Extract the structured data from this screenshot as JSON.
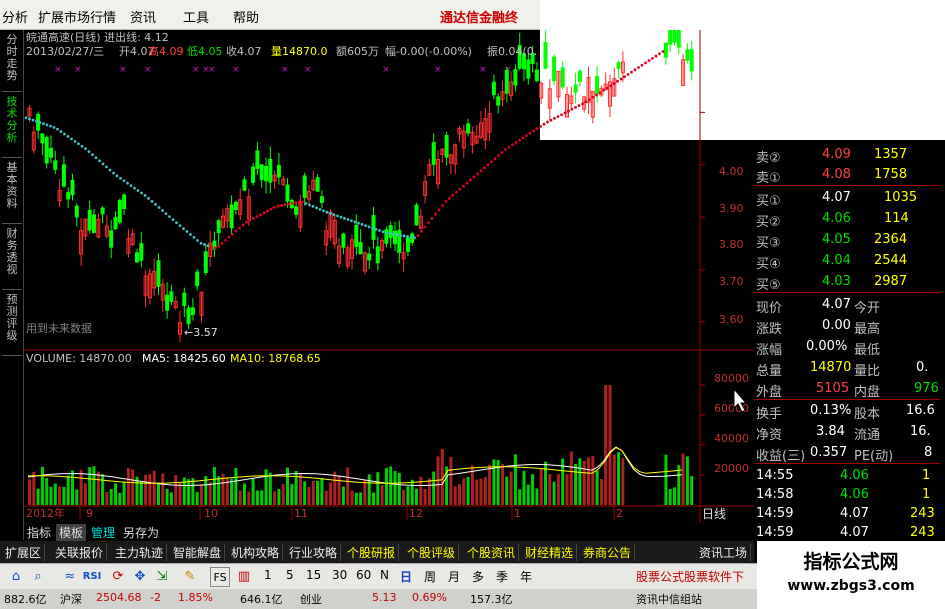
{
  "menu": {
    "item0": "分析",
    "item1": "扩展市场行情",
    "item2": "资讯",
    "item3": "工具",
    "item4": "帮助",
    "brand": "通达信金融终"
  },
  "left_tabs": [
    "分时走势",
    "技术分析",
    "基本资料",
    "财务透视",
    "预测评级"
  ],
  "chart_header": {
    "line1": "皖通高速(日线) 进出线: 4.12",
    "date": "2013/02/27/三",
    "open": "开4.07",
    "high": "高4.09",
    "low": "低4.05",
    "close": "收4.07",
    "vol": "量14870.0",
    "amount": "额605万",
    "range": "幅-0.00(-0.00%)",
    "amp": "振0.04(0.",
    "low_marker": "←3.57",
    "future": "用到未来数据"
  },
  "volume_header": {
    "vol": "VOLUME: 14870.00",
    "ma5": "MA5: 18425.60",
    "ma10": "MA10: 18768.65"
  },
  "price_axis": [
    "4.00",
    "3.90",
    "3.80",
    "3.70",
    "3.60"
  ],
  "vol_axis": [
    "80000",
    "60000",
    "40000",
    "20000"
  ],
  "x_axis": [
    "2012年",
    "9",
    "10",
    "11",
    "12",
    "1",
    "2"
  ],
  "period": "日线",
  "quote": {
    "asks": [
      {
        "label": "卖②",
        "price": "4.09",
        "vol": "1357"
      },
      {
        "label": "卖①",
        "price": "4.08",
        "vol": "1758"
      }
    ],
    "bids": [
      {
        "label": "买①",
        "price": "4.07",
        "vol": "1035"
      },
      {
        "label": "买②",
        "price": "4.06",
        "vol": "114"
      },
      {
        "label": "买③",
        "price": "4.05",
        "vol": "2364"
      },
      {
        "label": "买④",
        "price": "4.04",
        "vol": "2544"
      },
      {
        "label": "买⑤",
        "price": "4.03",
        "vol": "2987"
      }
    ],
    "stats": [
      {
        "k1": "现价",
        "v1": "4.07",
        "k2": "今开",
        "v2": ""
      },
      {
        "k1": "涨跌",
        "v1": "0.00",
        "k2": "最高",
        "v2": ""
      },
      {
        "k1": "涨幅",
        "v1": "0.00%",
        "k2": "最低",
        "v2": ""
      },
      {
        "k1": "总量",
        "v1": "14870",
        "k2": "量比",
        "v2": "0."
      },
      {
        "k1": "外盘",
        "v1": "5105",
        "k2": "内盘",
        "v2": "976"
      }
    ],
    "stats2": [
      {
        "k1": "换手",
        "v1": "0.13%",
        "k2": "股本",
        "v2": "16.6"
      },
      {
        "k1": "净资",
        "v1": "3.84",
        "k2": "流通",
        "v2": "16."
      },
      {
        "k1": "收益(三)",
        "v1": "0.357",
        "k2": "PE(动)",
        "v2": "8"
      }
    ],
    "ticks": [
      {
        "t": "14:55",
        "p": "4.06",
        "v": "1"
      },
      {
        "t": "14:58",
        "p": "4.06",
        "v": "1"
      },
      {
        "t": "14:59",
        "p": "4.07",
        "v": "243"
      },
      {
        "t": "14:59",
        "p": "4.07",
        "v": "243"
      }
    ]
  },
  "sub_tabs": [
    "指标",
    "模板",
    "管理",
    "另存为"
  ],
  "bottom_tabs": [
    "扩展区",
    "关联报价",
    "主力轨迹",
    "智能解盘",
    "机构攻略",
    "行业攻略",
    "个股研报",
    "个股评级",
    "个股资讯",
    "财经精选",
    "券商公告",
    "资讯工场"
  ],
  "toolbar": {
    "periods": [
      "1",
      "5",
      "15",
      "30",
      "60",
      "N",
      "日",
      "周",
      "月",
      "多",
      "季",
      "年"
    ],
    "fs": "FS",
    "rsi": "RSI",
    "ticker": "股票公式股票软件下"
  },
  "status": {
    "s1": "882.6亿",
    "s2": "沪深",
    "s3": "2504.68",
    "s4": "-2",
    "s5": "1.85%",
    "s6": "646.1亿",
    "s7": "创业",
    "s8": "5.13",
    "s9": "0.69%",
    "s10": "157.3亿",
    "s11": "资讯中信组站"
  },
  "watermark": {
    "line1": "指标公式网",
    "line2": "www.zbgs3.com"
  },
  "colors": {
    "up": "#ff3030",
    "down": "#00ff00",
    "ma_up": "#e00020",
    "ma_down": "#40c0c0",
    "axis": "#a00000",
    "ma5": "#ffffff",
    "ma10": "#ffff00"
  },
  "chart_data": {
    "type": "candlestick",
    "title": "皖通高速(日线)",
    "price_ylim": [
      3.55,
      4.1
    ],
    "price_ticks": [
      4.0,
      3.9,
      3.8,
      3.7,
      3.6
    ],
    "volume_ticks": [
      80000,
      60000,
      40000,
      20000
    ],
    "months": [
      "2012年",
      "9",
      "10",
      "11",
      "12",
      "1",
      "2"
    ],
    "low_marker": 3.57,
    "ma_line_value": 4.12,
    "last_bar": {
      "date": "2013/02/27",
      "open": 4.07,
      "high": 4.09,
      "low": 4.05,
      "close": 4.07,
      "volume": 14870
    },
    "vol_ma": {
      "MA5": 18425.6,
      "MA10": 18768.65
    }
  }
}
